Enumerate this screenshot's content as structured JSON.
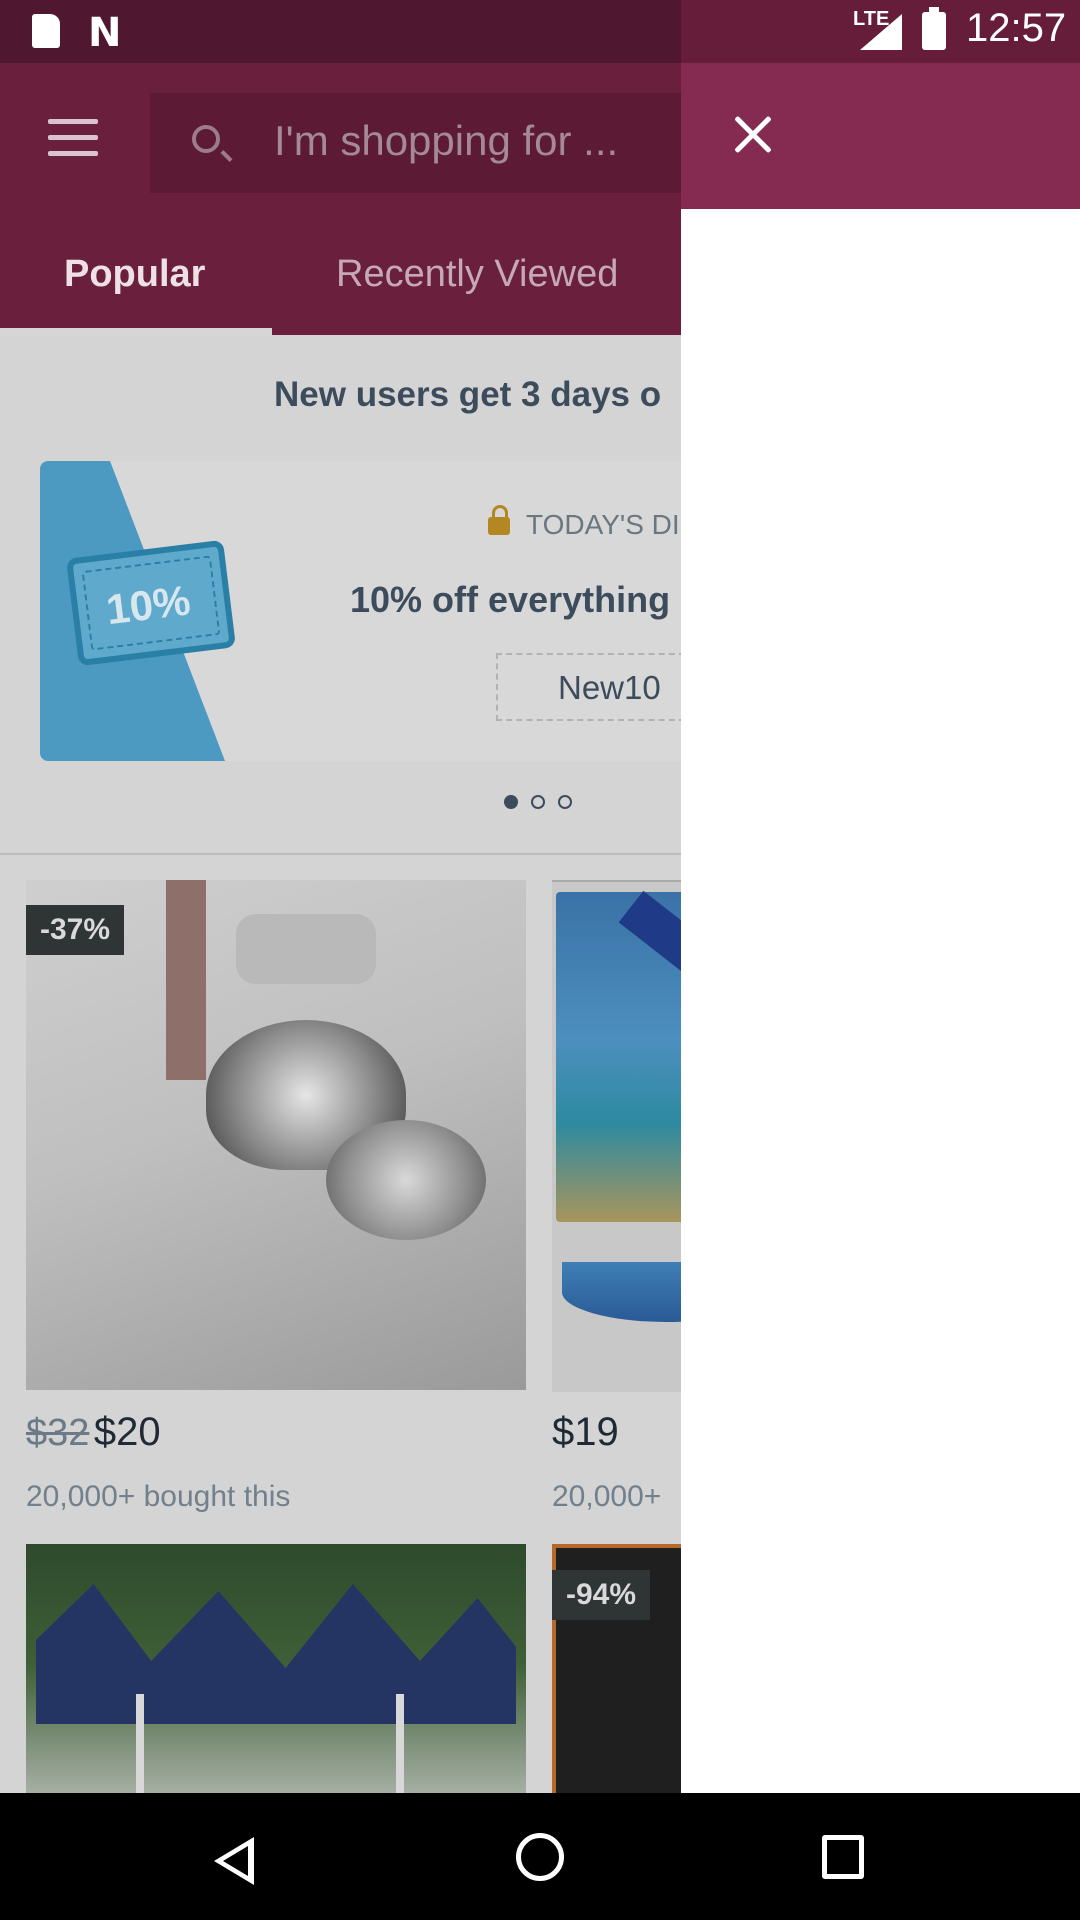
{
  "status_bar": {
    "network": "LTE",
    "time": "12:57",
    "notification_icons": [
      "sd-card-icon",
      "n-app-icon"
    ]
  },
  "header": {
    "search_placeholder": "I'm shopping for ...",
    "tabs": [
      {
        "label": "Popular",
        "selected": true
      },
      {
        "label": "Recently Viewed",
        "selected": false
      }
    ]
  },
  "banner": {
    "text": "New users get 3 days o"
  },
  "promo": {
    "coupon_text": "10%",
    "deal_label": "TODAY'S DI",
    "title": "10% off everything",
    "code": "New10",
    "active_slide": 1,
    "total_slides": 3
  },
  "products": [
    {
      "badge": "-37%",
      "old_price": "$32",
      "price": "$20",
      "bought": "20,000+ bought this"
    },
    {
      "badge": "",
      "old_price": "",
      "price": "$19",
      "bought": "20,000+"
    },
    {
      "badge": "",
      "old_price": "",
      "price": "",
      "bought": ""
    },
    {
      "badge": "-94%",
      "old_price": "",
      "price": "",
      "bought": ""
    }
  ],
  "drawer": {
    "open": true
  },
  "colors": {
    "brand": "#852a51",
    "overlay_dim": "#6a1f3c",
    "text_dark": "#3d4c5c"
  }
}
